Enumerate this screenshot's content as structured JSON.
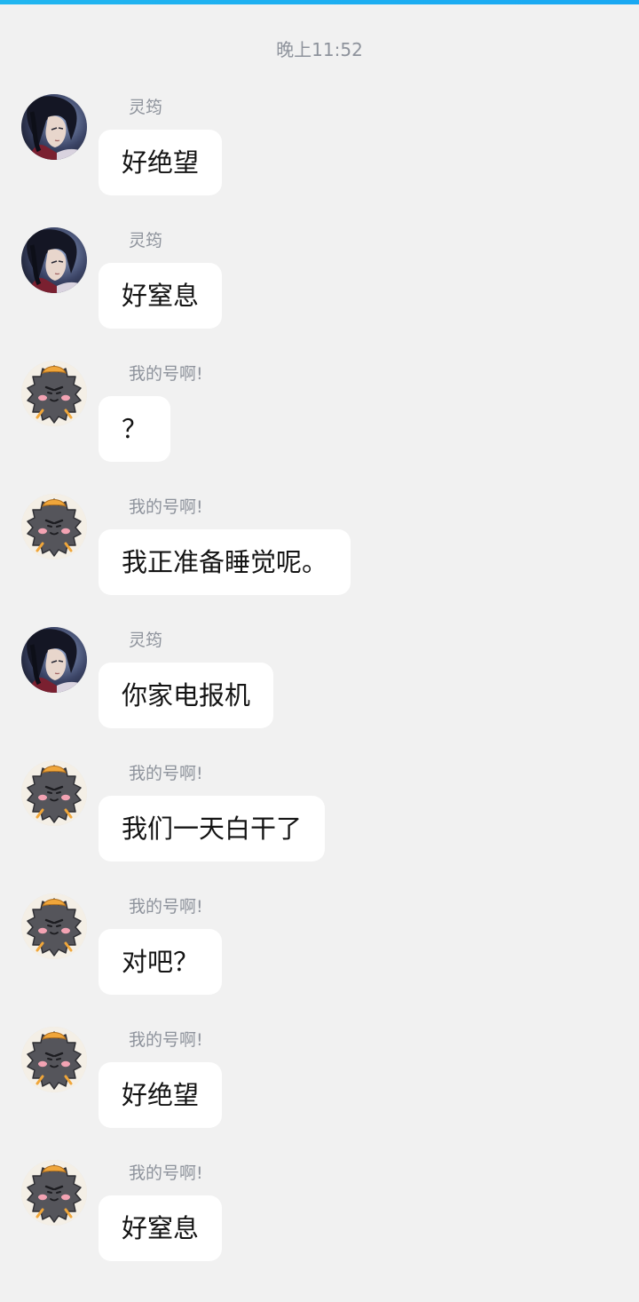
{
  "header": {
    "timestamp": "晚上11:52"
  },
  "messages": [
    {
      "sender": "灵筠",
      "text": "好绝望",
      "avatar": "anime-boy-avatar"
    },
    {
      "sender": "灵筠",
      "text": "好窒息",
      "avatar": "anime-boy-avatar"
    },
    {
      "sender": "我的号啊!",
      "text": "？",
      "avatar": "gray-cat-avatar"
    },
    {
      "sender": "我的号啊!",
      "text": "我正准备睡觉呢。",
      "avatar": "gray-cat-avatar"
    },
    {
      "sender": "灵筠",
      "text": "你家电报机",
      "avatar": "anime-boy-avatar"
    },
    {
      "sender": "我的号啊!",
      "text": "我们一天白干了",
      "avatar": "gray-cat-avatar"
    },
    {
      "sender": "我的号啊!",
      "text": "对吧？",
      "avatar": "gray-cat-avatar"
    },
    {
      "sender": "我的号啊!",
      "text": "好绝望",
      "avatar": "gray-cat-avatar"
    },
    {
      "sender": "我的号啊!",
      "text": "好窒息",
      "avatar": "gray-cat-avatar"
    }
  ],
  "colors": {
    "background": "#f1f1f1",
    "accent_bar": "#21b6f0",
    "bubble": "#ffffff",
    "meta_text": "#8e939c",
    "message_text": "#141414"
  }
}
